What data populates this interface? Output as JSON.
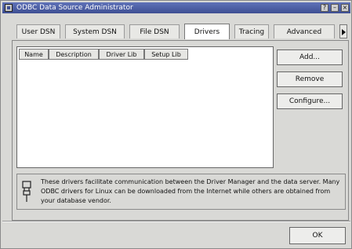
{
  "window": {
    "title": "ODBC Data Source Administrator",
    "controls": [
      "?",
      "–",
      "×"
    ]
  },
  "tabs": [
    {
      "label": "User DSN"
    },
    {
      "label": "System DSN"
    },
    {
      "label": "File DSN"
    },
    {
      "label": "Drivers"
    },
    {
      "label": "Tracing"
    },
    {
      "label": "Advanced"
    }
  ],
  "drivers_list": {
    "columns": [
      "Name",
      "Description",
      "Driver Lib",
      "Setup Lib"
    ]
  },
  "buttons": {
    "add": "Add...",
    "remove": "Remove",
    "configure": "Configure..."
  },
  "info": {
    "text": "These drivers facilitate communication between the Driver Manager and the data server. Many ODBC drivers for Linux can be downloaded from the Internet while others are obtained from your database vendor."
  },
  "footer": {
    "ok": "OK"
  }
}
